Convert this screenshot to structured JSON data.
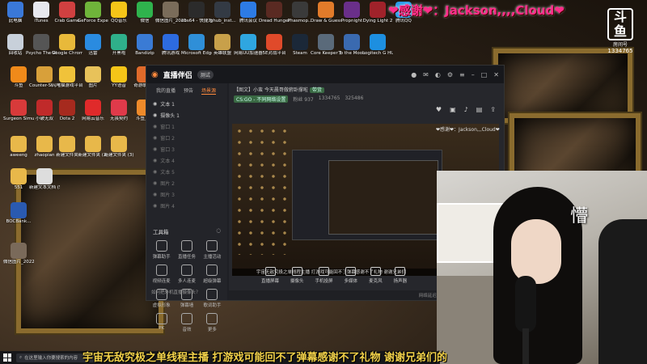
{
  "banner": {
    "text": "❤感谢❤：Jackson,,,,Cloud❤"
  },
  "platform_logo": {
    "mark": "斗鱼",
    "label": "房间号",
    "room_number": "1334765"
  },
  "desktop_icons": [
    {
      "label": "此电脑",
      "color": "#3a78d8"
    },
    {
      "label": "iTunes",
      "color": "#e8e8ee"
    },
    {
      "label": "Crab Game",
      "color": "#d04040"
    },
    {
      "label": "GeForce Experience",
      "color": "#6fb43a"
    },
    {
      "label": "QQ音乐",
      "color": "#f5c518"
    },
    {
      "label": "微信",
      "color": "#2fb34d"
    },
    {
      "label": "微信图片_2021111...",
      "color": "#7a6c5a"
    },
    {
      "label": "obs64 - 快捷方式",
      "color": "#2b2b2b"
    },
    {
      "label": "ighub_inst...",
      "color": "#333a44"
    },
    {
      "label": "腾讯会议",
      "color": "#2d7be5"
    },
    {
      "label": "Dread Hunger",
      "color": "#5a2a22"
    },
    {
      "label": "Phasmop...",
      "color": "#3a3a3a"
    },
    {
      "label": "Draw & Guess",
      "color": "#e27b2a"
    },
    {
      "label": "Propnight",
      "color": "#6a2f8a"
    },
    {
      "label": "Dying Light 2",
      "color": "#a0222a"
    },
    {
      "label": "腾讯QQ",
      "color": "#2a9be8"
    },
    {
      "label": "回收站",
      "color": "#c8d0da"
    },
    {
      "label": "Psycho The Wire Sou...",
      "color": "#555"
    },
    {
      "label": "Google Chrome",
      "color": "#e8b93a"
    },
    {
      "label": "迅雷",
      "color": "#2a8be0"
    },
    {
      "label": "开黑啦",
      "color": "#2fb08a"
    },
    {
      "label": "Bandizip",
      "color": "#3a7bd5"
    },
    {
      "label": "腾讯游戏",
      "color": "#2d6be0"
    },
    {
      "label": "Microsoft Edge",
      "color": "#2f8fd8"
    },
    {
      "label": "英雄联盟",
      "color": "#c8a04a"
    },
    {
      "label": "网易UU加速器",
      "color": "#2fa6e0"
    },
    {
      "label": "5E对战平台",
      "color": "#e04a2a"
    },
    {
      "label": "Steam",
      "color": "#1b2838"
    },
    {
      "label": "Core Keeper 服...",
      "color": "#5a6a7a"
    },
    {
      "label": "To the Moon",
      "color": "#3a6ab0"
    },
    {
      "label": "Logitech G HUB",
      "color": "#1d8fe0"
    },
    {
      "label": "斗鱼",
      "color": "#f08a1a"
    },
    {
      "label": "Counter-St... Global Off...",
      "color": "#d8a03a"
    },
    {
      "label": "闪电猫游戏平台",
      "color": "#f0c23a"
    },
    {
      "label": "图片",
      "color": "#e8c25a"
    },
    {
      "label": "YY语音",
      "color": "#f5c518"
    },
    {
      "label": "奇游联机宝",
      "color": "#e06a2a"
    },
    {
      "label": "Surgeon Simulator 2",
      "color": "#d83a3a"
    },
    {
      "label": "小破无双",
      "color": "#c02a2a"
    },
    {
      "label": "Dota 2",
      "color": "#a62a1e"
    },
    {
      "label": "网易云音乐",
      "color": "#e02a2a"
    },
    {
      "label": "无畏契约",
      "color": "#e03a4a"
    },
    {
      "label": "斗鱼直播",
      "color": "#ee8a2a"
    },
    {
      "label": "aweeng",
      "color": "#e8b84a"
    },
    {
      "label": "zhaopian",
      "color": "#e8b84a"
    },
    {
      "label": "新建文件夹",
      "color": "#e8b84a"
    },
    {
      "label": "新建文件夹 (2)",
      "color": "#e8b84a"
    },
    {
      "label": "新建文件夹 (3)",
      "color": "#e8b84a"
    },
    {
      "label": "551",
      "color": "#e8b84a"
    },
    {
      "label": "新建文本文档 (5)",
      "color": "#dddddd"
    },
    {
      "label": "BOCBank...",
      "color": "#2a5ab0"
    },
    {
      "label": "微信图片_2022011...",
      "color": "#7a6a5a"
    }
  ],
  "app": {
    "brand": "直播伴侣",
    "version_badge": "测试",
    "window_controls": [
      "头像",
      "消息",
      "皮肤",
      "设置",
      "菜单",
      "最小化",
      "最大化",
      "关闭"
    ],
    "left_tabs": [
      "我的直播",
      "预告",
      "场景源"
    ],
    "active_tab_index": 2,
    "scenes": [
      {
        "label": "文本 1",
        "dim": false
      },
      {
        "label": "摄像头 1",
        "dim": false
      },
      {
        "label": "窗口 1",
        "dim": true
      },
      {
        "label": "窗口 2",
        "dim": true
      },
      {
        "label": "窗口 3",
        "dim": true
      },
      {
        "label": "文本 4",
        "dim": true
      },
      {
        "label": "文本 5",
        "dim": true
      },
      {
        "label": "图片 2",
        "dim": true
      },
      {
        "label": "图片 3",
        "dim": true
      },
      {
        "label": "图片 4",
        "dim": true
      }
    ],
    "tools_title": "工具箱",
    "tools": [
      "弹幕助手",
      "直播任务",
      "主播活动",
      "视频连麦",
      "多人连麦",
      "超级弹幕",
      "虚拟形象",
      "弹幕墙",
      "歌词助手",
      "PK",
      "音效",
      "更多"
    ],
    "tip": "如何把外机直播摄像头？",
    "room": {
      "title": "【图文】小蛮 今天晨哥做俯卧撑啦",
      "tag": "带货",
      "category": "CS:GO - 不同网络设置",
      "follow_label": "粉丝 937",
      "hot": "1334765",
      "likes": "325486"
    },
    "gift_messages": [
      "❤感谢❤：Jackson,,,Cloud❤"
    ],
    "ticker": "宇宙无敌究极之单线程主播 打游戏可能回不了弹幕感谢不了礼物 谢谢兄弟们",
    "controls": [
      "直播屏幕",
      "摄像头",
      "手机投屏",
      "多媒体",
      "麦克风",
      "扬声器"
    ],
    "status": [
      "网络延迟",
      "帧率",
      "CPU",
      "内存"
    ]
  },
  "camera": {
    "caption_char": "懵"
  },
  "subtitle": "宇宙无敌究极之单线程主播 打游戏可能回不了弹幕感谢不了礼物 谢谢兄弟们的",
  "taskbar": {
    "search_placeholder": "在这里输入你要搜索的内容"
  }
}
